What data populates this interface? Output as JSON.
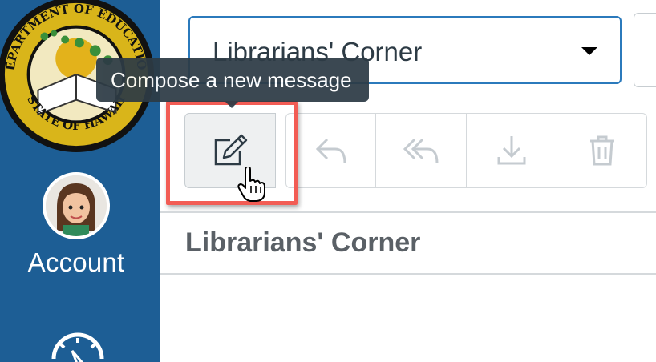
{
  "sidebar": {
    "seal": {
      "top_text": "DEPARTMENT OF EDUCATION",
      "bottom_text": "STATE OF HAWAII"
    },
    "account_label": "Account",
    "colors": {
      "background": "#1d5e95"
    }
  },
  "filters": {
    "course_select_value": "Librarians' Corner"
  },
  "toolbar": {
    "compose_icon": "compose-icon",
    "reply_icon": "reply-icon",
    "reply_all_icon": "reply-all-icon",
    "archive_icon": "download-icon",
    "delete_icon": "trash-icon"
  },
  "tooltip": {
    "text": "Compose a new message"
  },
  "conversation_list": {
    "title": "Librarians' Corner"
  },
  "colors": {
    "highlight": "#f25c54",
    "select_border": "#2b7abc",
    "tooltip_bg": "#2d3b45"
  }
}
